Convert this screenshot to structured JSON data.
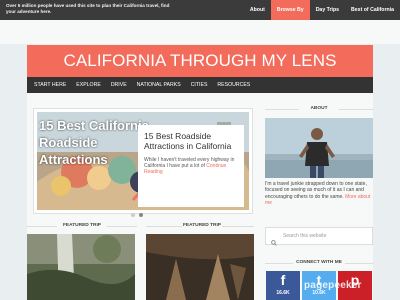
{
  "topbar": {
    "tagline": "Over 5 million people have used this site to plan their California travel, find your adventure here.",
    "nav": [
      "About",
      "Browse By",
      "Day Trips",
      "Best of California"
    ],
    "active": "Browse By"
  },
  "site": {
    "title": "CALIFORNIA THROUGH MY LENS"
  },
  "mainnav": [
    "START HERE",
    "EXPLORE",
    "DRIVE",
    "NATIONAL PARKS",
    "CITIES",
    "RESOURCES"
  ],
  "slider": {
    "image_text": "15 Best California Roadside Attractions",
    "heading": "15 Best Roadside Attractions in California",
    "excerpt": "While I haven't traveled every highway in California I have put a lot of",
    "excerpt_link": "Continue Reading",
    "dots": 2,
    "active_dot": 1
  },
  "featured": {
    "label_left": "FEATURED TRIP",
    "label_right": "FEATURED TRIP"
  },
  "sidebar": {
    "about_label": "ABOUT",
    "about_text": "I'm a travel junkie strapped down to one state, focused on seeing as much of it as I can and encouraging others to do the same.",
    "about_link": "More about me",
    "search_placeholder": "Search this website",
    "connect_label": "CONNECT WITH ME",
    "social": [
      {
        "name": "facebook",
        "glyph": "f",
        "count": "16.6K",
        "color": "#3b5998"
      },
      {
        "name": "twitter",
        "glyph": "t",
        "count": "10.6K",
        "color": "#55acee"
      },
      {
        "name": "pinterest",
        "glyph": "p",
        "count": "",
        "color": "#cb2027"
      }
    ],
    "watermark": "pagepeeker"
  }
}
